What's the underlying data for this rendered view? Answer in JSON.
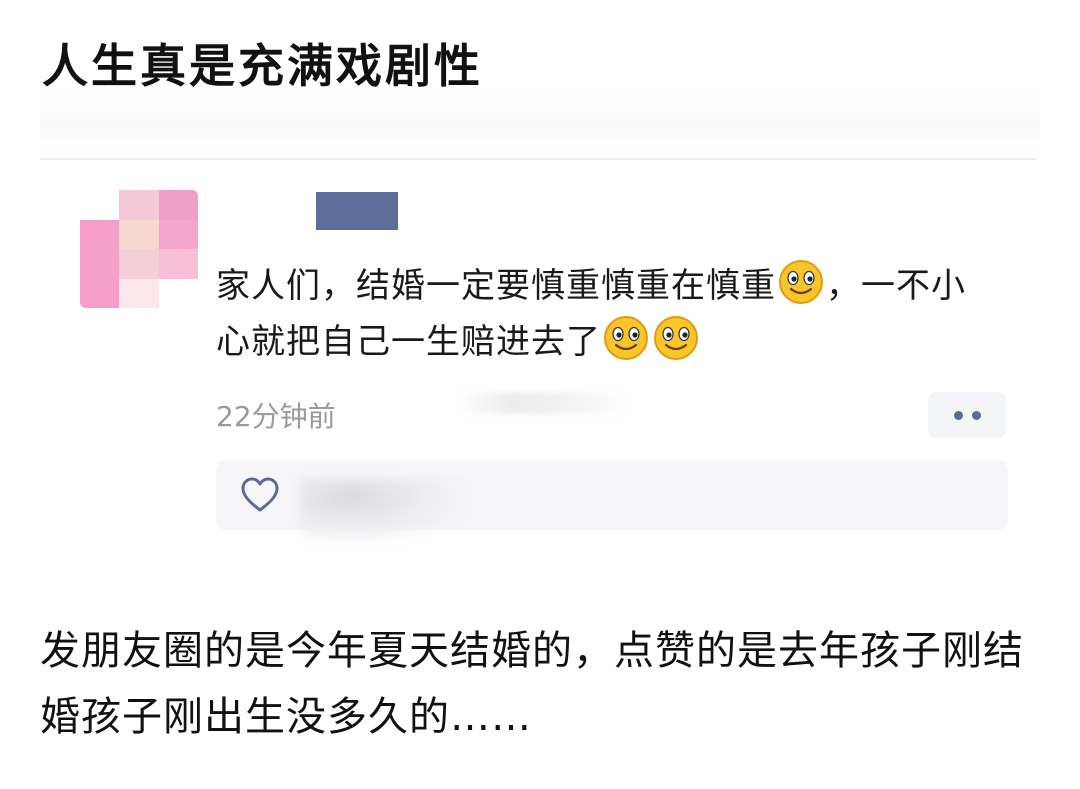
{
  "post": {
    "title": "人生真是充满戏剧性",
    "caption": "发朋友圈的是今年夏天结婚的，点赞的是去年孩子刚结婚孩子刚出生没多久的……"
  },
  "moment": {
    "comment_part1": "家人们，结婚一定要慎重慎重在慎重",
    "comment_part2": "，一不小心就把自己一生赔进去了",
    "time": "22分钟前",
    "emoji_name": "smile-emoji"
  },
  "icons": {
    "more": "more-dots-icon",
    "like": "heart-icon"
  },
  "colors": {
    "redaction_block": "#5e6e9a",
    "time_text": "#9a9a9a",
    "more_dots": "#5b6b94",
    "like_panel": "#f6f6f8",
    "avatar_pink": "#f49ec9"
  }
}
